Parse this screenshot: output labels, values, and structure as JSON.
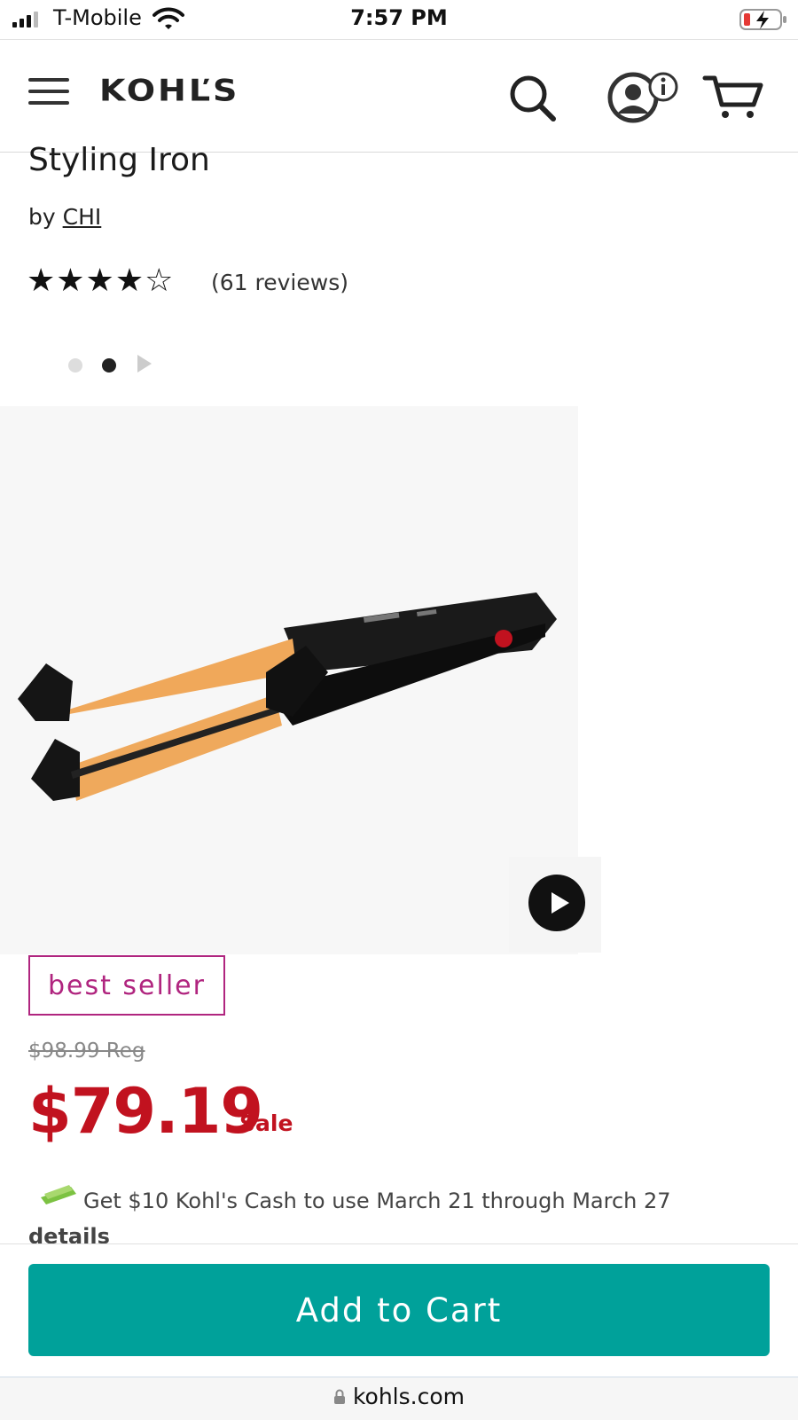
{
  "status_bar": {
    "carrier": "T-Mobile",
    "time": "7:57 PM",
    "battery_color": "#e53935"
  },
  "header": {
    "logo": "KOHĽS",
    "icons": [
      "menu-icon",
      "search-icon",
      "account-icon",
      "info-icon",
      "cart-icon"
    ]
  },
  "product": {
    "title": "Styling Iron",
    "by_prefix": "by",
    "brand": "CHI",
    "rating": 4,
    "rating_max": 5,
    "stars_text": "★★★★☆",
    "reviews": "(61 reviews)",
    "carousel_active_index": 1
  },
  "badge": "best seller",
  "price": {
    "regular": "$98.99 Reg",
    "sale": "$79.19",
    "sale_label": "Sale"
  },
  "promo": {
    "text": "Get $10 Kohl's Cash to use March 21 through March 27",
    "details": "details"
  },
  "actions": {
    "add_to_cart": "Add to Cart"
  },
  "browser": {
    "url": "kohls.com"
  },
  "colors": {
    "accent": "#00a19a",
    "sale": "#c1121f",
    "badge": "#b0257f"
  }
}
